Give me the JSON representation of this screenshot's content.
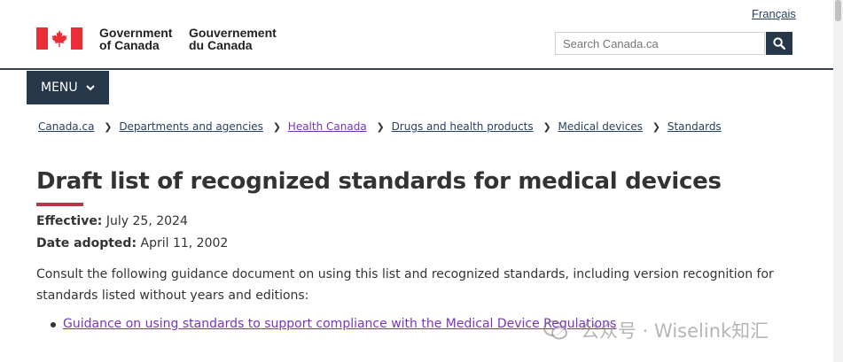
{
  "header": {
    "language_toggle": "Français",
    "wordmark_en": [
      "Government",
      "of Canada"
    ],
    "wordmark_fr": [
      "Gouvernement",
      "du Canada"
    ],
    "search": {
      "placeholder": "Search Canada.ca"
    },
    "menu_label": "MENU"
  },
  "breadcrumb": [
    {
      "label": "Canada.ca",
      "visited": false
    },
    {
      "label": "Departments and agencies",
      "visited": false
    },
    {
      "label": "Health Canada",
      "visited": true
    },
    {
      "label": "Drugs and health products",
      "visited": false
    },
    {
      "label": "Medical devices",
      "visited": false
    },
    {
      "label": "Standards",
      "visited": false
    }
  ],
  "main": {
    "title": "Draft list of recognized standards for medical devices",
    "effective_label": "Effective:",
    "effective_value": "July 25, 2024",
    "adopted_label": "Date adopted:",
    "adopted_value": "April 11, 2002",
    "intro": "Consult the following guidance document on using this list and recognized standards, including version recognition for standards listed without years and editions:",
    "links": [
      "Guidance on using standards to support compliance with the Medical Device Regulations"
    ]
  },
  "watermark": "公众号 · Wiselink知汇",
  "colors": {
    "header_dark": "#26374a",
    "accent_red": "#af3c43",
    "link": "#284162",
    "visited_link": "#7834bc"
  }
}
